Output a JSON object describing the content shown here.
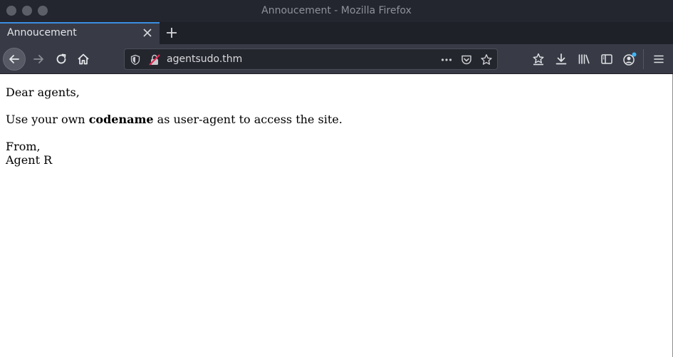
{
  "window": {
    "title": "Annoucement - Mozilla Firefox"
  },
  "tab": {
    "label": "Annoucement",
    "close_icon": "close-icon"
  },
  "newtab": {
    "icon": "plus-icon"
  },
  "nav": {
    "back_icon": "arrow-left-icon",
    "forward_icon": "arrow-right-icon",
    "reload_icon": "reload-icon",
    "home_icon": "home-icon"
  },
  "urlbar": {
    "value": "agentsudo.thm",
    "shield_icon": "shield-icon",
    "insecure_icon": "insecure-lock-icon",
    "more_icon": "more-dots-icon",
    "pocket_icon": "pocket-icon",
    "bookmark_icon": "star-icon"
  },
  "toolbar": {
    "icons": [
      "bookmarks-star-icon",
      "download-icon",
      "library-icon",
      "sidebar-icon",
      "account-icon",
      "menu-icon"
    ]
  },
  "page": {
    "greeting": "Dear agents,",
    "line_prefix": "Use your own ",
    "line_bold": "codename",
    "line_suffix": " as user-agent to access the site.",
    "from": "From,",
    "signature": "Agent R"
  },
  "colors": {
    "titlebar_bg": "#23252f",
    "toolbar_bg": "#383b46",
    "tab_accent": "#3b8ee0",
    "account_badge": "#42b4f5"
  }
}
